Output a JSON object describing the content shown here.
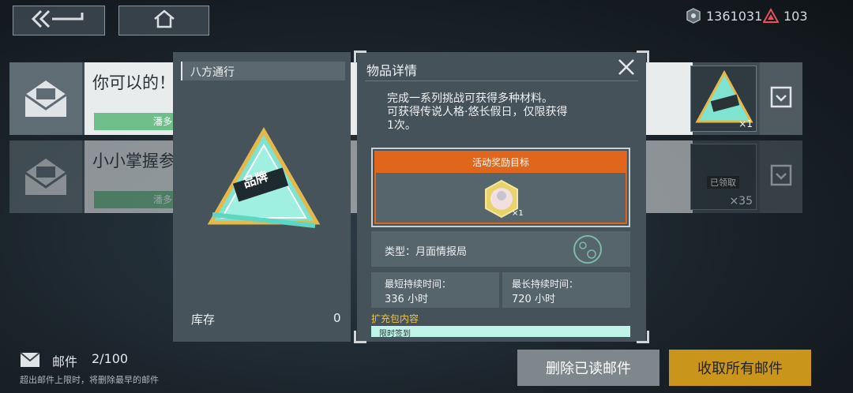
{
  "topbar": {
    "back_icon": "double-chevron-back-icon",
    "home_icon": "home-icon",
    "currency1": {
      "icon": "coin-eye-icon",
      "value": "1361031"
    },
    "currency2": {
      "icon": "red-triangle-icon",
      "value": "103"
    }
  },
  "mails": [
    {
      "title": "你可以的！",
      "sender": "潘多",
      "item_count": "×1"
    },
    {
      "title": "小小掌握参",
      "sender": "潘多",
      "item_status": "已领取",
      "item_count": "×35"
    }
  ],
  "left_panel": {
    "title": "八方通行",
    "item_badge": "品牌",
    "stock_label": "库存",
    "stock_value": "0"
  },
  "detail": {
    "title": "物品详情",
    "desc_line1": "完成一系列挑战可获得多种材料。",
    "desc_line2": "可获得传说人格·悠长假日，仅限获得",
    "desc_line3": "1次。",
    "reward_header": "活动奖励目标",
    "reward_count": "×1",
    "type_label": "类型：月面情报局",
    "min_time_label": "最短持续时间：",
    "min_time_value": "336 小时",
    "max_time_label": "最长持续时间：",
    "max_time_value": "720 小时",
    "pack_label": "扩充包内容",
    "pack_item": "限时签到"
  },
  "footer": {
    "mail_label": "邮件",
    "mail_count": "2/100",
    "mail_note": "超出邮件上限时，将删除最早的邮件",
    "delete_read_label": "删除已读邮件",
    "collect_all_label": "收取所有邮件"
  },
  "colors": {
    "accent_orange": "#e0661c",
    "collect_gold": "#c9951a",
    "teal": "#7fe3d2"
  }
}
